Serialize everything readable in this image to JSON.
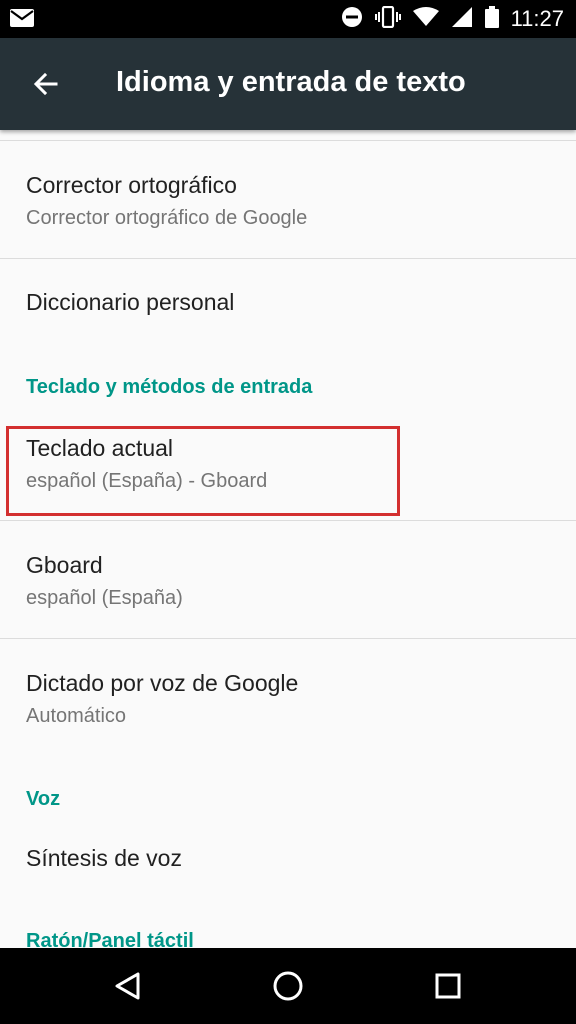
{
  "status_bar": {
    "time": "11:27",
    "icons": [
      "mail-icon",
      "do-not-disturb-icon",
      "vibrate-icon",
      "wifi-icon",
      "signal-icon",
      "battery-icon"
    ]
  },
  "app_bar": {
    "title": "Idioma y entrada de texto",
    "back_icon": "arrow-back-icon"
  },
  "items": {
    "spell_checker": {
      "title": "Corrector ortográfico",
      "subtitle": "Corrector ortográfico de Google"
    },
    "personal_dictionary": {
      "title": "Diccionario personal"
    },
    "current_keyboard": {
      "title": "Teclado actual",
      "subtitle": "español (España) - Gboard"
    },
    "gboard": {
      "title": "Gboard",
      "subtitle": "español (España)"
    },
    "voice_dictation": {
      "title": "Dictado por voz de Google",
      "subtitle": "Automático"
    },
    "tts": {
      "title": "Síntesis de voz"
    }
  },
  "sections": {
    "keyboards": "Teclado y métodos de entrada",
    "voice": "Voz",
    "mouse": "Ratón/Panel táctil"
  },
  "colors": {
    "accent": "#009688",
    "app_bar": "#263238",
    "highlight": "#d32f2f"
  },
  "nav_bar": {
    "icons": [
      "back-triangle-icon",
      "home-circle-icon",
      "recents-square-icon"
    ]
  }
}
